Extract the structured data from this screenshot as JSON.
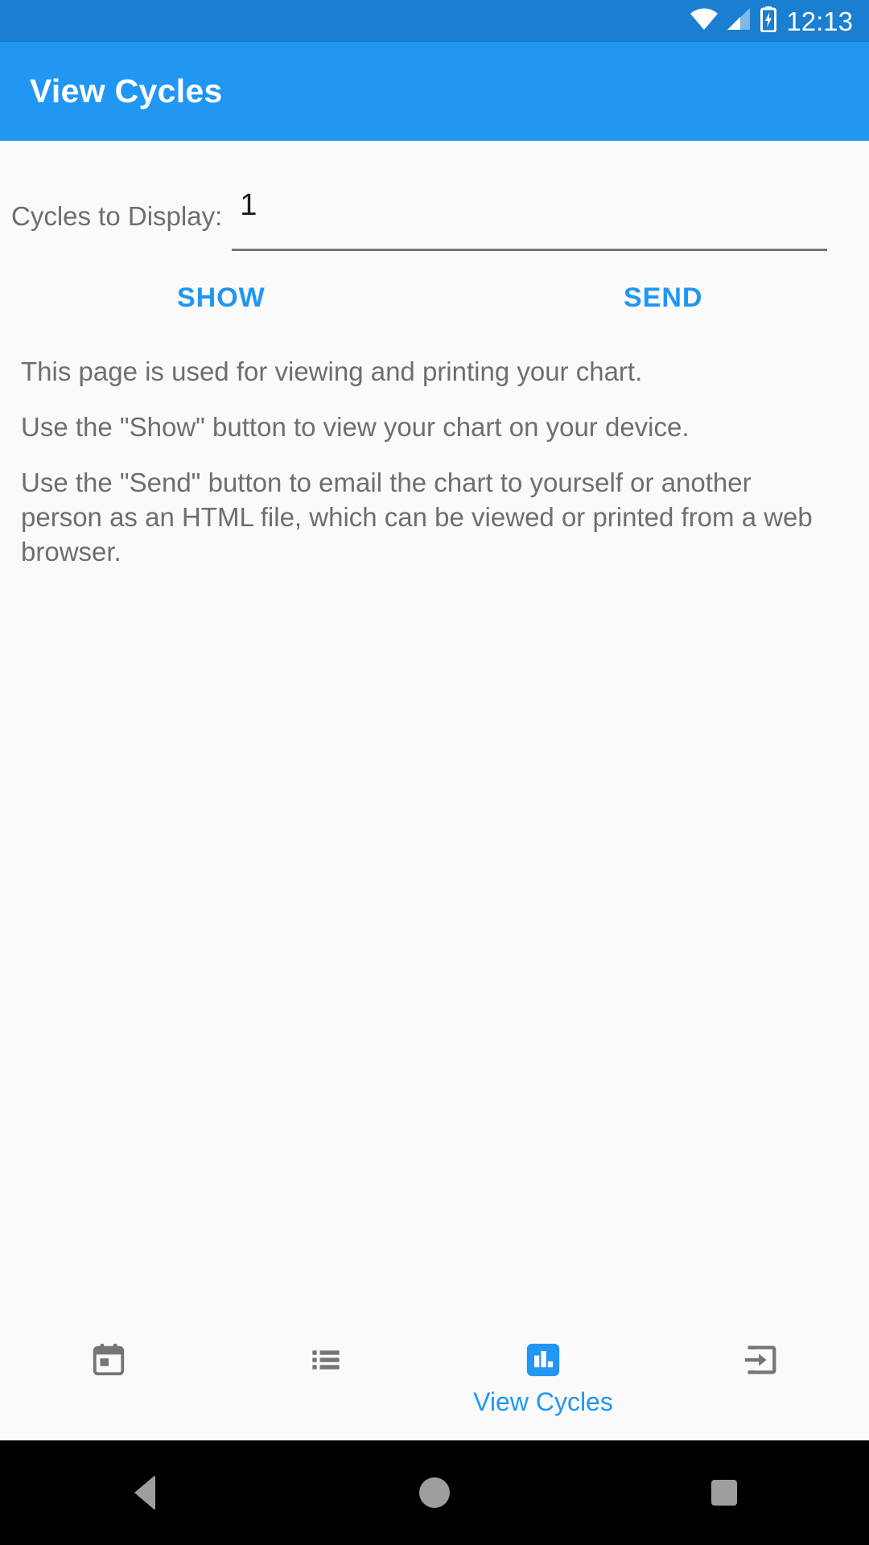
{
  "status_bar": {
    "time": "12:13",
    "icons": [
      "wifi-icon",
      "cellular-signal-icon",
      "battery-charging-icon"
    ],
    "background_color": "#1a7ed1"
  },
  "app_bar": {
    "title": "View Cycles",
    "background_color": "#2196f3",
    "title_color": "#ffffff"
  },
  "form": {
    "label": "Cycles to Display:",
    "value": "1",
    "placeholder": ""
  },
  "actions": {
    "show_label": "SHOW",
    "send_label": "SEND",
    "accent_color": "#2196f3"
  },
  "help_text": {
    "paragraphs": [
      "This page is used for viewing and printing your chart.",
      "Use the \"Show\" button to view your chart on your device.",
      "Use the \"Send\" button to email the chart to yourself or another person as an HTML file, which can be viewed or printed from a web browser."
    ],
    "text_color": "#6e6e6e"
  },
  "bottom_nav": {
    "items": [
      {
        "icon": "calendar-icon",
        "label": "",
        "active": false
      },
      {
        "icon": "list-icon",
        "label": "",
        "active": false
      },
      {
        "icon": "bar-chart-icon",
        "label": "View Cycles",
        "active": true
      },
      {
        "icon": "export-login-icon",
        "label": "",
        "active": false
      }
    ],
    "active_color": "#2196f3",
    "inactive_color": "#757575"
  },
  "system_nav": {
    "back": "back-triangle",
    "home": "home-circle",
    "recents": "recents-square",
    "background_color": "#000000",
    "icon_color": "#9e9e9e"
  }
}
